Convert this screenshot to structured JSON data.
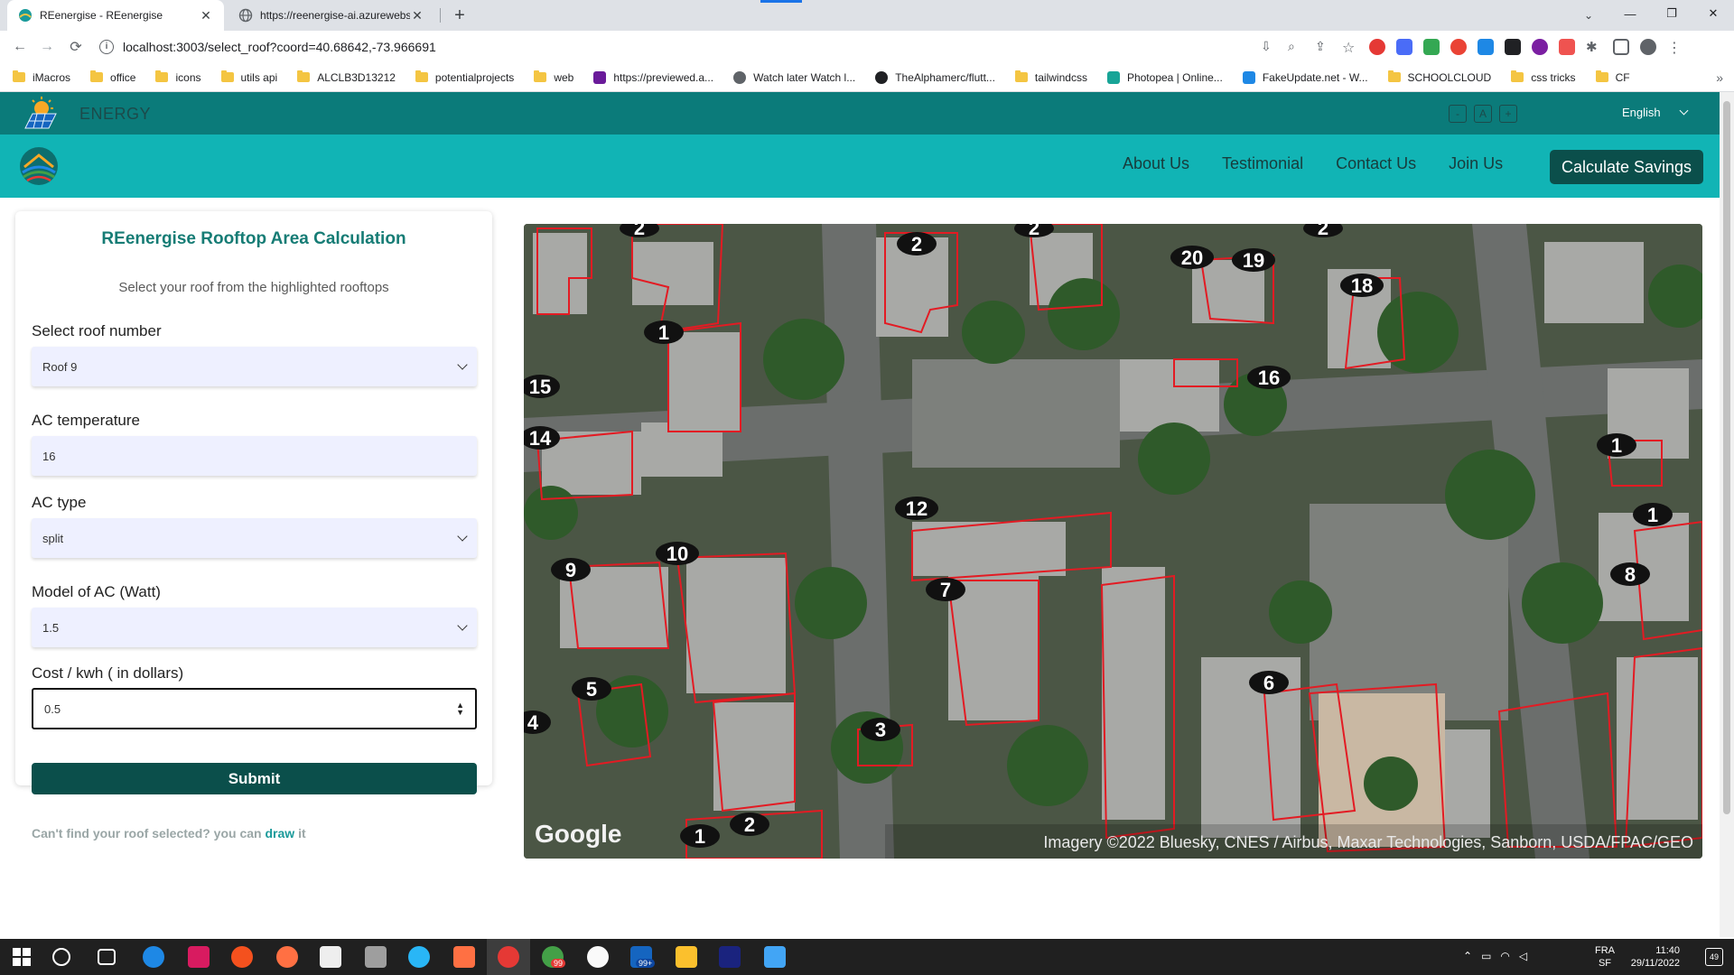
{
  "browser": {
    "tabs": [
      {
        "title": "REenergise - REenergise",
        "active": true
      },
      {
        "title": "https://reenergise-ai.azurewebsit",
        "active": false
      }
    ],
    "url": "localhost:3003/select_roof?coord=40.68642,-73.966691",
    "bookmarks": [
      {
        "label": "iMacros",
        "icon": "folder-icon"
      },
      {
        "label": "office",
        "icon": "folder-icon"
      },
      {
        "label": "icons",
        "icon": "folder-icon"
      },
      {
        "label": "utils api",
        "icon": "folder-icon"
      },
      {
        "label": "ALCLB3D13212",
        "icon": "folder-icon"
      },
      {
        "label": "potentialprojects",
        "icon": "folder-icon"
      },
      {
        "label": "web",
        "icon": "folder-icon"
      },
      {
        "label": "https://previewed.a...",
        "icon": "site-icon"
      },
      {
        "label": "Watch later Watch l...",
        "icon": "site-icon"
      },
      {
        "label": "TheAlphamerc/flutt...",
        "icon": "github-icon"
      },
      {
        "label": "tailwindcss",
        "icon": "folder-icon"
      },
      {
        "label": "Photopea | Online...",
        "icon": "site-icon"
      },
      {
        "label": "FakeUpdate.net - W...",
        "icon": "site-icon"
      },
      {
        "label": "SCHOOLCLOUD",
        "icon": "folder-icon"
      },
      {
        "label": "css tricks",
        "icon": "folder-icon"
      },
      {
        "label": "CF",
        "icon": "folder-icon"
      }
    ]
  },
  "site": {
    "brand": "ENERGY",
    "font_buttons": [
      "-",
      "A",
      "+"
    ],
    "language": "English",
    "nav": [
      "About Us",
      "Testimonial",
      "Contact Us",
      "Join Us"
    ],
    "cta": "Calculate Savings"
  },
  "form": {
    "title": "REenergise Rooftop Area Calculation",
    "subtitle": "Select your roof from the highlighted rooftops",
    "roof_label": "Select roof number",
    "roof_value": "Roof 9",
    "ac_temp_label": "AC temperature",
    "ac_temp_value": "16",
    "ac_type_label": "AC type",
    "ac_type_value": "split",
    "model_label": "Model of AC (Watt)",
    "model_value": "1.5",
    "cost_label": "Cost / kwh ( in dollars)",
    "cost_value": "0.5",
    "submit": "Submit",
    "hint_prefix": "Can't find your roof selected? you can",
    "hint_link": "draw",
    "hint_suffix": "it"
  },
  "map": {
    "watermark": "Google",
    "attribution": "Imagery ©2022 Bluesky, CNES / Airbus, Maxar Technologies, Sanborn, USDA/FPAC/GEO",
    "roof_markers": [
      "2",
      "1",
      "15",
      "14",
      "12",
      "10",
      "9",
      "7",
      "5",
      "3",
      "1",
      "2",
      "20",
      "19",
      "18",
      "16",
      "6",
      "1",
      "1",
      "8",
      "4",
      "2",
      "2",
      "2"
    ]
  },
  "taskbar": {
    "lang_top": "FRA",
    "lang_bottom": "SF",
    "time": "11:40",
    "date": "29/11/2022",
    "notifications": "49",
    "mail_badge": "99+",
    "whatsapp_badge": "99"
  }
}
